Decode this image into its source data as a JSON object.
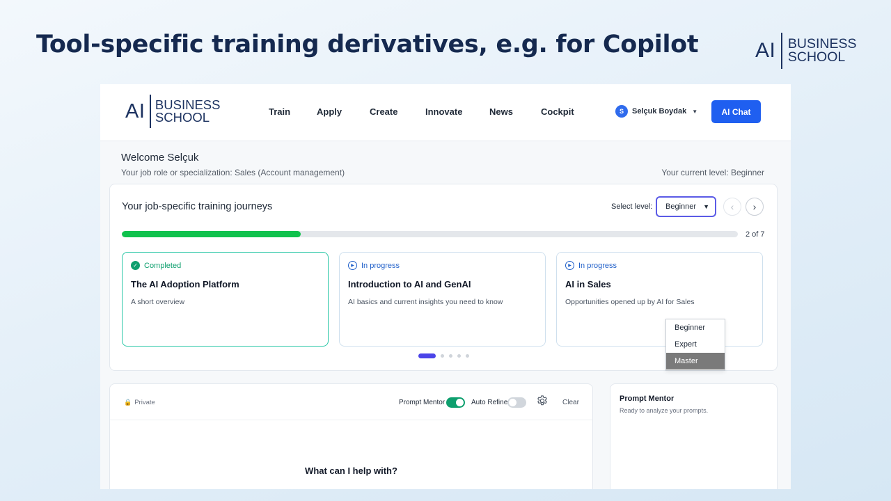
{
  "slide": {
    "title": "Tool-specific training derivatives, e.g. for Copilot",
    "brand": {
      "ai": "AI",
      "line1": "BUSINESS",
      "line2": "SCHOOL"
    }
  },
  "app": {
    "brand": {
      "ai": "AI",
      "line1": "BUSINESS",
      "line2": "SCHOOL"
    },
    "nav": [
      "Train",
      "Apply",
      "Create",
      "Innovate",
      "News",
      "Cockpit"
    ],
    "user": {
      "initial": "S",
      "name": "Selçuk Boydak"
    },
    "ai_chat_label": "AI Chat",
    "welcome": "Welcome Selçuk",
    "role": "Your job role or specialization: Sales (Account management)",
    "current_level": "Your current level: Beginner",
    "journeys": {
      "title": "Your job-specific training journeys",
      "select_label": "Select level:",
      "selected_level": "Beginner",
      "level_options": [
        "Beginner",
        "Expert",
        "Master"
      ],
      "highlighted_option": "Master",
      "progress": {
        "fraction": 0.29,
        "text": "2 of 7"
      },
      "courses": [
        {
          "status": "Completed",
          "title": "The AI Adoption Platform",
          "description": "A short overview"
        },
        {
          "status": "In progress",
          "title": "Introduction to AI and GenAI",
          "description": "AI basics and current insights you need to know"
        },
        {
          "status": "In progress",
          "title": "AI in Sales",
          "description": "Opportunities opened up by AI for Sales"
        }
      ],
      "pagination": {
        "count": 5,
        "active": 0
      }
    },
    "chat": {
      "private_label": "Private",
      "prompt_mentor_label": "Prompt Mentor",
      "prompt_mentor_on": true,
      "auto_refine_label": "Auto Refine",
      "auto_refine_on": false,
      "clear_label": "Clear",
      "placeholder_heading": "What can I help with?"
    },
    "mentor": {
      "title": "Prompt Mentor",
      "subtitle": "Ready to analyze your prompts."
    }
  },
  "colors": {
    "accent": "#1f5ff0",
    "progress": "#10c24d",
    "completed": "#0e9f6e",
    "in_progress": "#1f5fc9",
    "select_border": "#5b5be6"
  }
}
